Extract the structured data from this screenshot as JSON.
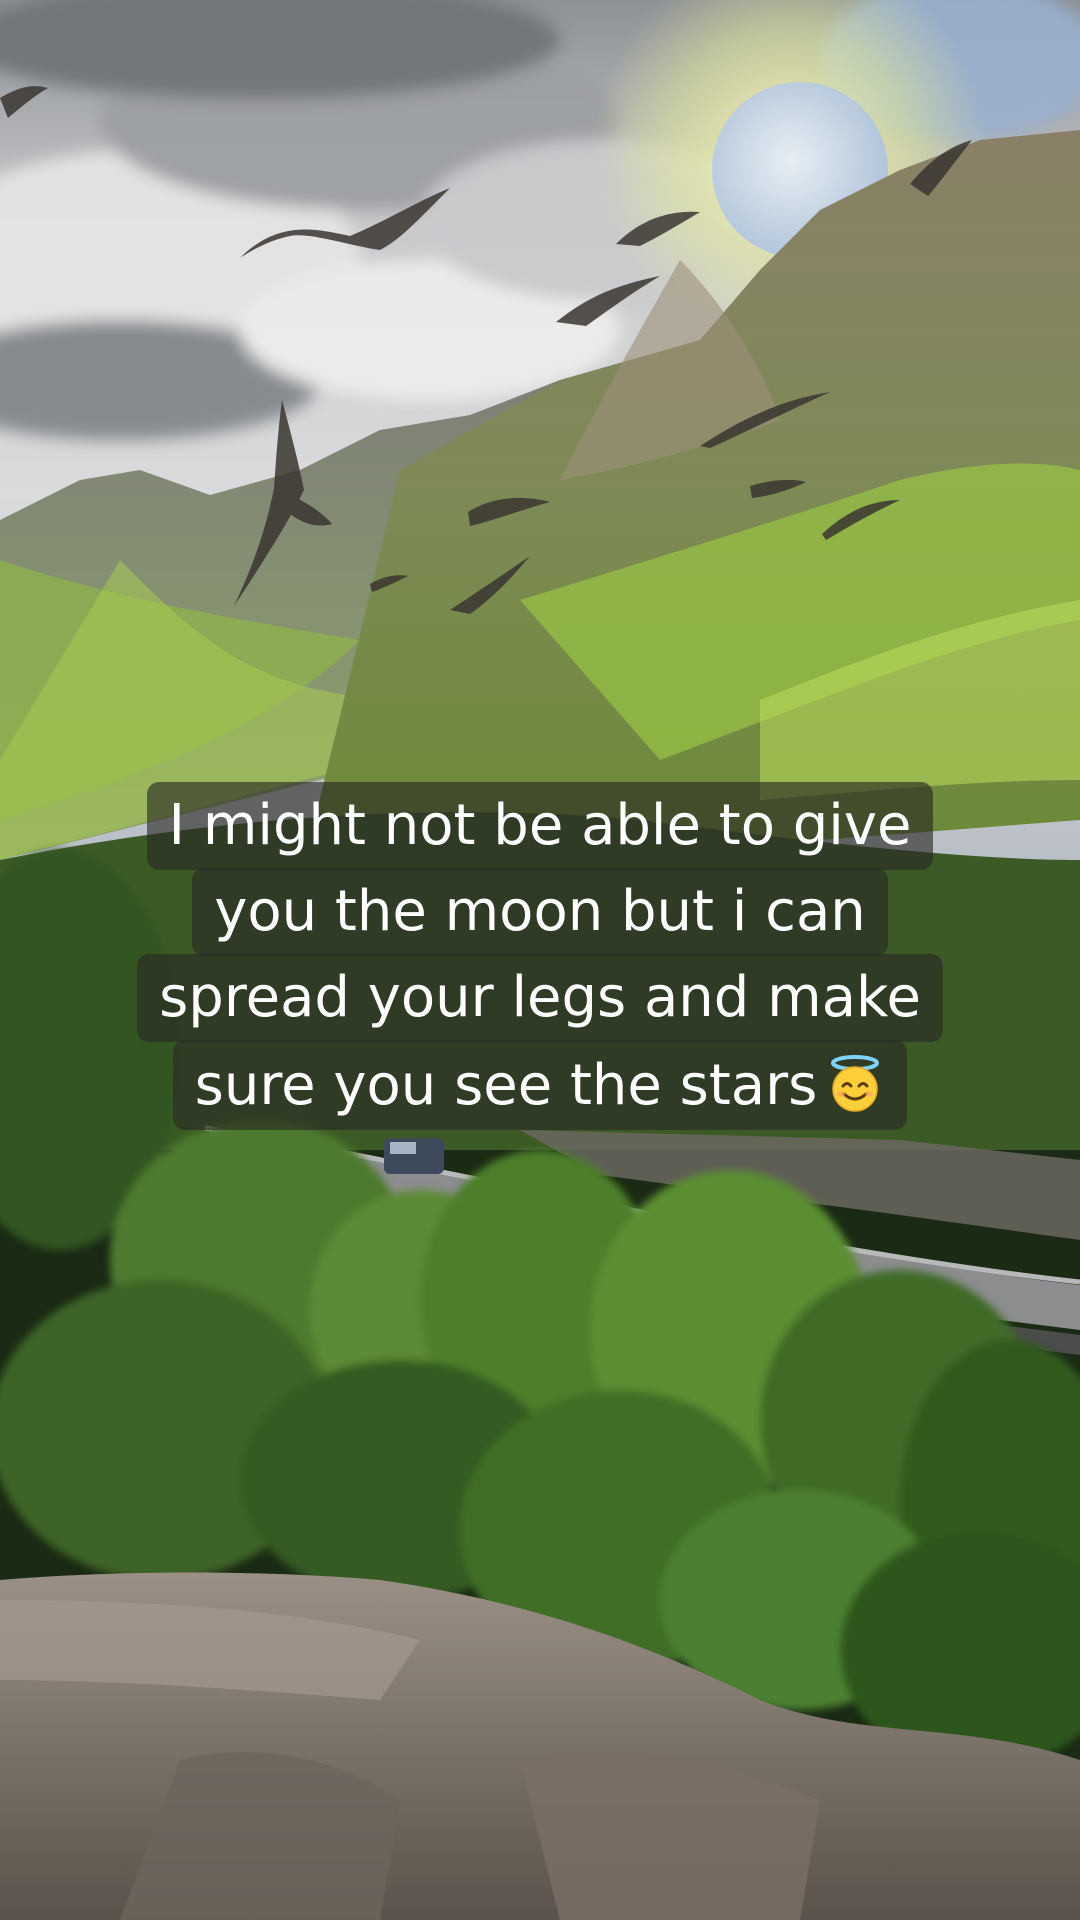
{
  "caption": {
    "lines": [
      "I might not be able to give",
      "you the moon but i can",
      "spread your legs and make",
      "sure you see the stars"
    ],
    "emoji": "smiling-face-with-halo-icon"
  },
  "colors": {
    "caption_text": "#ffffff",
    "caption_background": "#28281f",
    "sky": "#b9bcbf",
    "grass": "#8fbf3a",
    "rock": "#8a7f74"
  }
}
